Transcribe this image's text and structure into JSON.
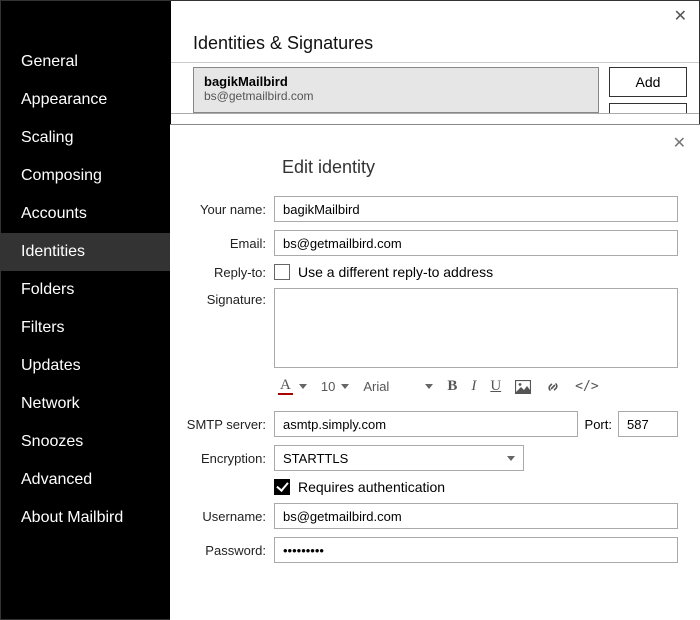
{
  "sidebar": {
    "items": [
      {
        "label": "General"
      },
      {
        "label": "Appearance"
      },
      {
        "label": "Scaling"
      },
      {
        "label": "Composing"
      },
      {
        "label": "Accounts"
      },
      {
        "label": "Identities",
        "selected": true
      },
      {
        "label": "Folders"
      },
      {
        "label": "Filters"
      },
      {
        "label": "Updates"
      },
      {
        "label": "Network"
      },
      {
        "label": "Snoozes"
      },
      {
        "label": "Advanced"
      },
      {
        "label": "About Mailbird"
      }
    ]
  },
  "page": {
    "title": "Identities & Signatures"
  },
  "identity_card": {
    "name": "bagikMailbird",
    "email": "bs@getmailbird.com"
  },
  "buttons": {
    "add": "Add"
  },
  "modal": {
    "title": "Edit identity",
    "labels": {
      "your_name": "Your name:",
      "email": "Email:",
      "reply_to": "Reply-to:",
      "signature": "Signature:",
      "smtp": "SMTP server:",
      "port": "Port:",
      "encryption": "Encryption:",
      "requires_auth": "Requires authentication",
      "username": "Username:",
      "password": "Password:",
      "use_diff_reply": "Use a different reply-to address"
    },
    "values": {
      "your_name": "bagikMailbird",
      "email": "bs@getmailbird.com",
      "signature": "",
      "smtp": "asmtp.simply.com",
      "port": "587",
      "encryption": "STARTTLS",
      "username": "bs@getmailbird.com",
      "password": "•••••••••"
    },
    "toolbar": {
      "font_size": "10",
      "font_family": "Arial"
    },
    "checks": {
      "use_diff_reply": false,
      "requires_auth": true
    }
  }
}
